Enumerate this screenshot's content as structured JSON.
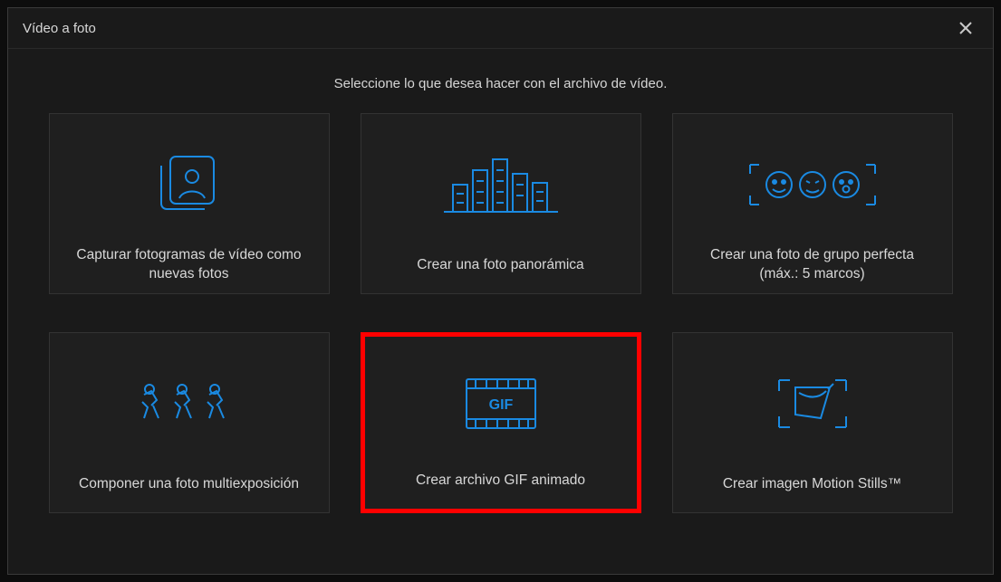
{
  "dialog": {
    "title": "Vídeo a foto",
    "subtitle": "Seleccione lo que desea hacer con el archivo de vídeo.",
    "options": [
      {
        "label": "Capturar fotogramas de vídeo como nuevas fotos"
      },
      {
        "label": "Crear una foto panorámica"
      },
      {
        "label": "Crear una foto de grupo perfecta (máx.: 5 marcos)"
      },
      {
        "label": "Componer una foto multiexposición"
      },
      {
        "label": "Crear archivo GIF animado"
      },
      {
        "label": "Crear imagen Motion Stills™"
      }
    ],
    "highlighted_index": 4
  }
}
